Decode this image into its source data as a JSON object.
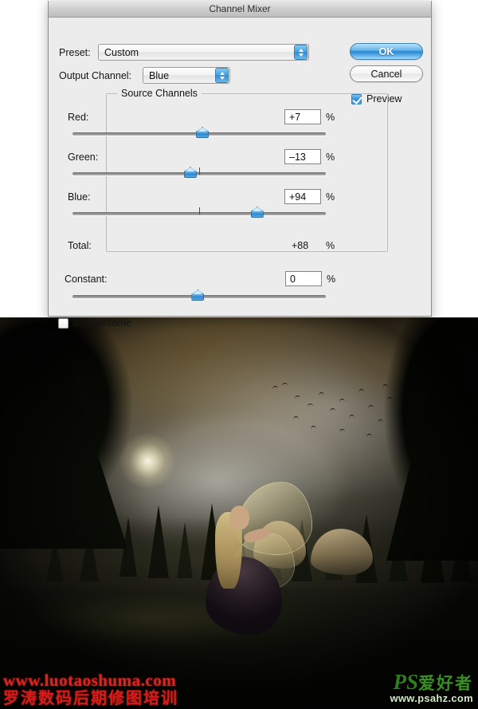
{
  "dialog": {
    "title": "Channel Mixer",
    "preset": {
      "label": "Preset:",
      "value": "Custom",
      "menu_icon": "preset-options-icon"
    },
    "output_channel": {
      "label": "Output Channel:",
      "value": "Blue"
    },
    "buttons": {
      "ok": "OK",
      "cancel": "Cancel"
    },
    "preview": {
      "label": "Preview",
      "checked": true
    },
    "source_channels": {
      "legend": "Source Channels",
      "rows": [
        {
          "label": "Red:",
          "value": "+7",
          "unit": "%",
          "slider_pct": 51.3,
          "has_tick": false,
          "tick_pct": 50
        },
        {
          "label": "Green:",
          "value": "–13",
          "unit": "%",
          "slider_pct": 46.5,
          "has_tick": true,
          "tick_pct": 50
        },
        {
          "label": "Blue:",
          "value": "+94",
          "unit": "%",
          "slider_pct": 72.9,
          "has_tick": true,
          "tick_pct": 50
        }
      ],
      "total": {
        "label": "Total:",
        "value": "+88",
        "unit": "%"
      }
    },
    "constant": {
      "label": "Constant:",
      "value": "0",
      "unit": "%",
      "slider_pct": 49.5
    },
    "monochrome": {
      "label": "Monochrome",
      "checked": false
    }
  },
  "watermarks": {
    "left": {
      "url": "www.luotaoshuma.com",
      "cn": "罗涛数码后期修图培训",
      "color": "#e02020"
    },
    "right": {
      "brand_ps": "PS",
      "brand_cn": "爱好者",
      "site": "www.psahz.com",
      "color": "#2f7d1e"
    }
  },
  "photo": {
    "description": "fairy-in-forest-photo-composite"
  }
}
